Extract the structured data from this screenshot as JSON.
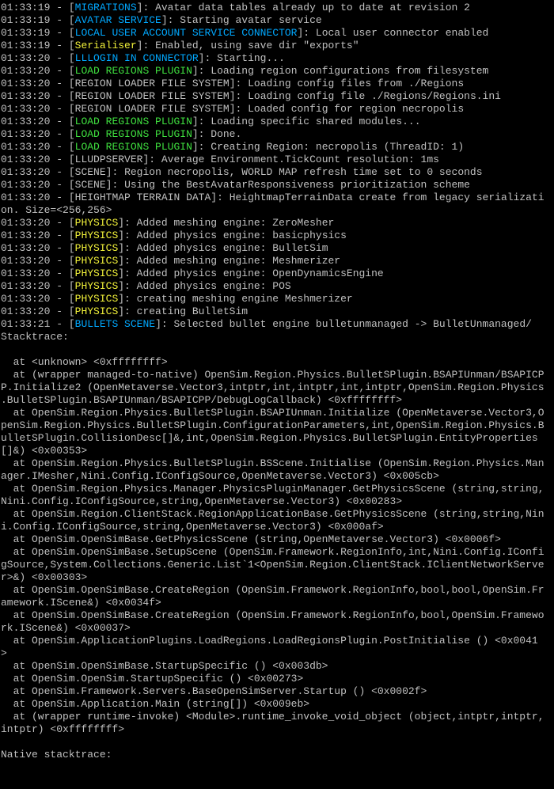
{
  "terminal": {
    "colors": {
      "background": "#000000",
      "text": "#c0c0c0",
      "cyan": "#00a8ff",
      "green": "#3fe03f",
      "yellow": "#f2f23a"
    },
    "lines": [
      {
        "time": "01:33:19",
        "tag": "MIGRATIONS",
        "color": "cyan",
        "msg": "Avatar data tables already up to date at revision 2"
      },
      {
        "time": "01:33:19",
        "tag": "AVATAR SERVICE",
        "color": "cyan",
        "msg": "Starting avatar service"
      },
      {
        "time": "01:33:19",
        "tag": "LOCAL USER ACCOUNT SERVICE CONNECTOR",
        "color": "cyan",
        "msg": "Local user connector enabled"
      },
      {
        "time": "01:33:19",
        "tag": "Serialiser",
        "color": "yellow",
        "msg": "Enabled, using save dir \"exports\""
      },
      {
        "time": "01:33:20",
        "tag": "LLLOGIN IN CONNECTOR",
        "color": "cyan",
        "msg": "Starting..."
      },
      {
        "time": "01:33:20",
        "tag": "LOAD REGIONS PLUGIN",
        "color": "green",
        "msg": "Loading region configurations from filesystem"
      },
      {
        "time": "01:33:20",
        "tag": "REGION LOADER FILE SYSTEM",
        "color": "white",
        "msg": "Loading config files from ./Regions"
      },
      {
        "time": "01:33:20",
        "tag": "REGION LOADER FILE SYSTEM",
        "color": "white",
        "msg": "Loading config file ./Regions/Regions.ini"
      },
      {
        "time": "01:33:20",
        "tag": "REGION LOADER FILE SYSTEM",
        "color": "white",
        "msg": "Loaded config for region necropolis"
      },
      {
        "time": "01:33:20",
        "tag": "LOAD REGIONS PLUGIN",
        "color": "green",
        "msg": "Loading specific shared modules..."
      },
      {
        "time": "01:33:20",
        "tag": "LOAD REGIONS PLUGIN",
        "color": "green",
        "msg": "Done."
      },
      {
        "time": "01:33:20",
        "tag": "LOAD REGIONS PLUGIN",
        "color": "green",
        "msg": "Creating Region: necropolis (ThreadID: 1)"
      },
      {
        "time": "01:33:20",
        "tag": "LLUDPSERVER",
        "color": "white",
        "msg": "Average Environment.TickCount resolution: 1ms"
      },
      {
        "time": "01:33:20",
        "tag": "SCENE",
        "color": "white",
        "msg": "Region necropolis, WORLD MAP refresh time set to 0 seconds"
      },
      {
        "time": "01:33:20",
        "tag": "SCENE",
        "color": "white",
        "msg": "Using the BestAvatarResponsiveness prioritization scheme"
      },
      {
        "time": "01:33:20",
        "tag": "HEIGHTMAP TERRAIN DATA",
        "color": "white",
        "msg": "HeightmapTerrainData create from legacy serializati"
      },
      {
        "raw": "on. Size=<256,256>"
      },
      {
        "time": "01:33:20",
        "tag": "PHYSICS",
        "color": "yellow",
        "msg": "Added meshing engine: ZeroMesher"
      },
      {
        "time": "01:33:20",
        "tag": "PHYSICS",
        "color": "yellow",
        "msg": "Added physics engine: basicphysics"
      },
      {
        "time": "01:33:20",
        "tag": "PHYSICS",
        "color": "yellow",
        "msg": "Added physics engine: BulletSim"
      },
      {
        "time": "01:33:20",
        "tag": "PHYSICS",
        "color": "yellow",
        "msg": "Added meshing engine: Meshmerizer"
      },
      {
        "time": "01:33:20",
        "tag": "PHYSICS",
        "color": "yellow",
        "msg": "Added physics engine: OpenDynamicsEngine"
      },
      {
        "time": "01:33:20",
        "tag": "PHYSICS",
        "color": "yellow",
        "msg": "Added physics engine: POS"
      },
      {
        "time": "01:33:20",
        "tag": "PHYSICS",
        "color": "yellow",
        "msg": "creating meshing engine Meshmerizer"
      },
      {
        "time": "01:33:20",
        "tag": "PHYSICS",
        "color": "yellow",
        "msg": "creating BulletSim"
      },
      {
        "time": "01:33:21",
        "tag": "BULLETS SCENE",
        "color": "cyan",
        "msg": "Selected bullet engine bulletunmanaged -> BulletUnmanaged/"
      },
      {
        "raw": "Stacktrace:"
      },
      {
        "raw": ""
      },
      {
        "raw": "  at <unknown> <0xffffffff>"
      },
      {
        "raw": "  at (wrapper managed-to-native) OpenSim.Region.Physics.BulletSPlugin.BSAPIUnman/BSAPICP"
      },
      {
        "raw": "P.Initialize2 (OpenMetaverse.Vector3,intptr,int,intptr,int,intptr,OpenSim.Region.Physics"
      },
      {
        "raw": ".BulletSPlugin.BSAPIUnman/BSAPICPP/DebugLogCallback) <0xffffffff>"
      },
      {
        "raw": "  at OpenSim.Region.Physics.BulletSPlugin.BSAPIUnman.Initialize (OpenMetaverse.Vector3,O"
      },
      {
        "raw": "penSim.Region.Physics.BulletSPlugin.ConfigurationParameters,int,OpenSim.Region.Physics.B"
      },
      {
        "raw": "ulletSPlugin.CollisionDesc[]&,int,OpenSim.Region.Physics.BulletSPlugin.EntityProperties"
      },
      {
        "raw": "[]&) <0x00353>"
      },
      {
        "raw": "  at OpenSim.Region.Physics.BulletSPlugin.BSScene.Initialise (OpenSim.Region.Physics.Man"
      },
      {
        "raw": "ager.IMesher,Nini.Config.IConfigSource,OpenMetaverse.Vector3) <0x005cb>"
      },
      {
        "raw": "  at OpenSim.Region.Physics.Manager.PhysicsPluginManager.GetPhysicsScene (string,string,"
      },
      {
        "raw": "Nini.Config.IConfigSource,string,OpenMetaverse.Vector3) <0x00283>"
      },
      {
        "raw": "  at OpenSim.Region.ClientStack.RegionApplicationBase.GetPhysicsScene (string,string,Nin"
      },
      {
        "raw": "i.Config.IConfigSource,string,OpenMetaverse.Vector3) <0x000af>"
      },
      {
        "raw": "  at OpenSim.OpenSimBase.GetPhysicsScene (string,OpenMetaverse.Vector3) <0x0006f>"
      },
      {
        "raw": "  at OpenSim.OpenSimBase.SetupScene (OpenSim.Framework.RegionInfo,int,Nini.Config.IConfi"
      },
      {
        "raw": "gSource,System.Collections.Generic.List`1<OpenSim.Region.ClientStack.IClientNetworkServe"
      },
      {
        "raw": "r>&) <0x00303>"
      },
      {
        "raw": "  at OpenSim.OpenSimBase.CreateRegion (OpenSim.Framework.RegionInfo,bool,bool,OpenSim.Fr"
      },
      {
        "raw": "amework.IScene&) <0x0034f>"
      },
      {
        "raw": "  at OpenSim.OpenSimBase.CreateRegion (OpenSim.Framework.RegionInfo,bool,OpenSim.Framewo"
      },
      {
        "raw": "rk.IScene&) <0x00037>"
      },
      {
        "raw": "  at OpenSim.ApplicationPlugins.LoadRegions.LoadRegionsPlugin.PostInitialise () <0x0041"
      },
      {
        "raw": ">"
      },
      {
        "raw": "  at OpenSim.OpenSimBase.StartupSpecific () <0x003db>"
      },
      {
        "raw": "  at OpenSim.OpenSim.StartupSpecific () <0x00273>"
      },
      {
        "raw": "  at OpenSim.Framework.Servers.BaseOpenSimServer.Startup () <0x0002f>"
      },
      {
        "raw": "  at OpenSim.Application.Main (string[]) <0x009eb>"
      },
      {
        "raw": "  at (wrapper runtime-invoke) <Module>.runtime_invoke_void_object (object,intptr,intptr,"
      },
      {
        "raw": "intptr) <0xffffffff>"
      },
      {
        "raw": ""
      },
      {
        "raw": "Native stacktrace:"
      },
      {
        "raw": ""
      }
    ]
  }
}
